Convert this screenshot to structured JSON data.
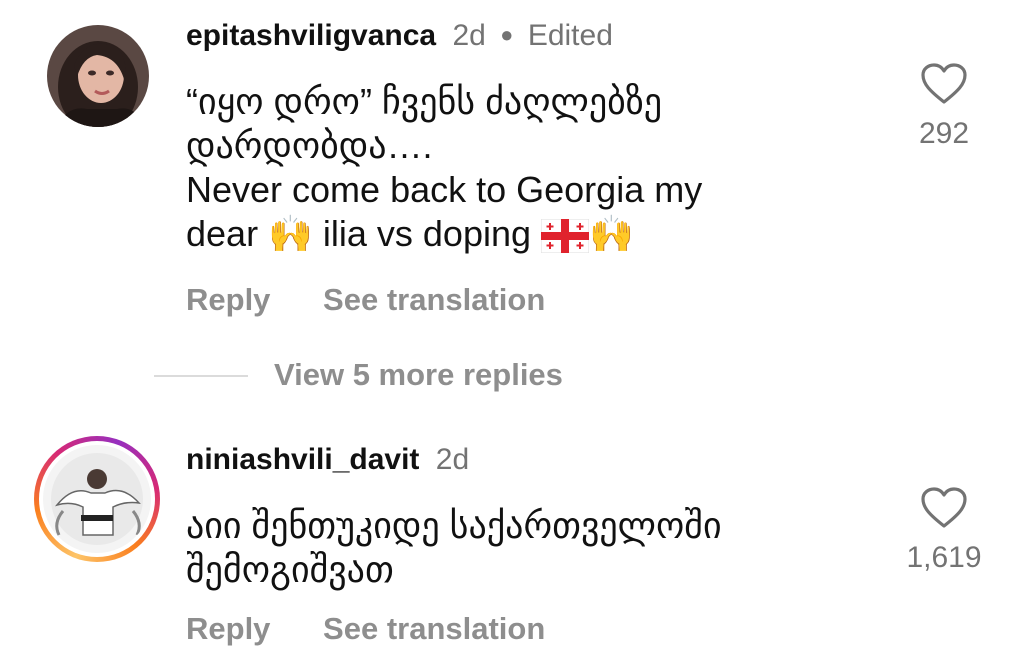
{
  "comments": [
    {
      "username": "epitashviligvanca",
      "time": "2d",
      "edited": "Edited",
      "lines": [
        "“იყო დრო” ჩვენს ძაღლებზე",
        "დარდობდა….",
        "Never come back to Georgia my"
      ],
      "last_line": {
        "a": "dear ",
        "emoji1": "🙌",
        "b": " ilia vs doping ",
        "emoji2": "🙌"
      },
      "likes": "292",
      "reply_label": "Reply",
      "translate_label": "See translation"
    },
    {
      "username": "niniashvili_davit",
      "time": "2d",
      "lines": [
        "აიი შენთუკიდე საქართველოში",
        "შემოგიშვათ"
      ],
      "likes": "1,619",
      "reply_label": "Reply",
      "translate_label": "See translation"
    }
  ],
  "view_replies_label": "View 5 more replies",
  "colors": {
    "muted": "#737373",
    "action": "#8e8e8e",
    "ring": [
      "#fdc468",
      "#fa7e1e",
      "#d62976",
      "#962fbf"
    ]
  },
  "icons": {
    "like": "heart-icon",
    "clap": "raising-hands-emoji",
    "flag": "georgia-flag"
  }
}
